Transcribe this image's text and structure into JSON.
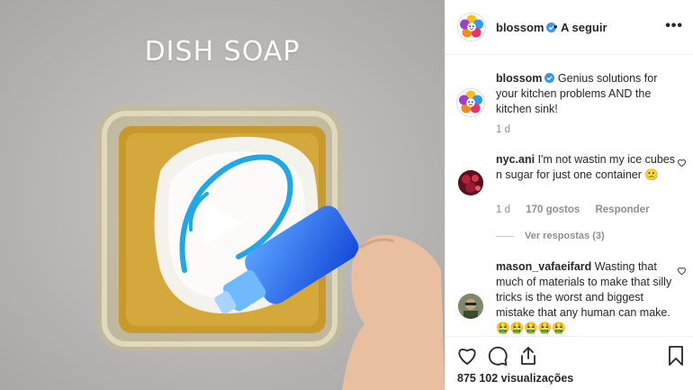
{
  "video": {
    "overlay_text": "DISH SOAP"
  },
  "header": {
    "username": "blossom",
    "separator": "•",
    "follow_label": "A seguir",
    "more_label": "•••"
  },
  "caption": {
    "username": "blossom",
    "text": "Genius solutions for your kitchen problems AND the kitchen sink!",
    "time": "1 d"
  },
  "comments": [
    {
      "username": "nyc.ani",
      "text": "I'm not wastin my ice cubes n sugar for just one container 🙁",
      "time": "1 d",
      "likes": "170 gostos",
      "reply_label": "Responder",
      "view_replies": "Ver respostas (3)"
    },
    {
      "username": "mason_vafaeifard",
      "text": "Wasting that much of materials to make that silly tricks is the worst and biggest mistake that any human can make.",
      "emoji": "🤮🤮🤮🤮🤮"
    }
  ],
  "stats": {
    "views": "875 102 visualizações"
  },
  "icons": {
    "like": "heart-icon",
    "comment": "comment-icon",
    "share": "share-icon",
    "save": "bookmark-icon",
    "play": "play-icon",
    "verified": "verified-badge-icon"
  },
  "colors": {
    "verified": "#3897f0",
    "text": "#262626",
    "muted": "#8e8e8e",
    "soap": "#2aa6e8"
  }
}
